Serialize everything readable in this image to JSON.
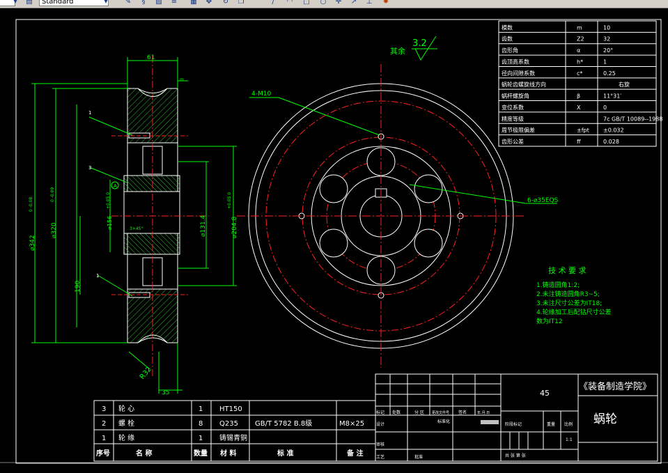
{
  "toolbar": {
    "layer_combo": "",
    "style_combo": "Standard",
    "icons": [
      "dropdown-icon",
      "table-style-icon",
      "dropdown-icon",
      "pencil-icon",
      "swirl-icon",
      "hatch-icon",
      "text-icon",
      "move-icon",
      "rotate-icon",
      "copy-icon",
      "line-icon",
      "rectangle-icon",
      "circle-icon",
      "arrow-icon",
      "highlight-icon"
    ]
  },
  "colors": {
    "background": "#000000",
    "outline": "#ffffff",
    "center_line": "#ff2020",
    "dimension": "#00ff00",
    "title_accent": "#00ff00"
  },
  "side_view": {
    "dim_61": "61",
    "dim_35": "35",
    "dim_190": "190",
    "dim_diam_342": "⌀342",
    "dim_diam_320": "⌀320",
    "dim_diam_131": "⌀131.4",
    "dim_diam_204": "⌀204.8",
    "dim_diam_hub": "⌀156",
    "tol_342": "0  -0.08",
    "tol_320": "0  -0.09",
    "tol_204": "+0.05  0",
    "tol_hub": "+0.05  0",
    "radius": "R32",
    "chamfer_top": "m",
    "label_keyway": "3×45°",
    "leader_1a": "1",
    "leader_3": "3",
    "leader_1b": "1",
    "datum": "A"
  },
  "front_view": {
    "note_holes_4": "4-M10",
    "note_holes_6": "6-⌀35EQS"
  },
  "surface_finish": {
    "label": "其余",
    "value": "3.2"
  },
  "param_table": [
    {
      "name": "模数",
      "symbol": "m",
      "value": "10"
    },
    {
      "name": "齿数",
      "symbol": "Z2",
      "value": "32"
    },
    {
      "name": "齿形角",
      "symbol": "α",
      "value": "20°"
    },
    {
      "name": "齿顶高系数",
      "symbol": "h*",
      "value": "1"
    },
    {
      "name": "径向间隙系数",
      "symbol": "c*",
      "value": "0.25"
    },
    {
      "name": "蜗轮齿螺旋线方向",
      "symbol": "",
      "value": "右旋"
    },
    {
      "name": "蜗杆螺旋角",
      "symbol": "β",
      "value": "11°31′"
    },
    {
      "name": "变位系数",
      "symbol": "X",
      "value": "0"
    },
    {
      "name": "精度等级",
      "symbol": "",
      "value": "7c GB/T 10089--1988"
    },
    {
      "name": "周节极限偏差",
      "symbol": "±fpt",
      "value": "±0.032"
    },
    {
      "name": "齿形公差",
      "symbol": "ff",
      "value": "0.028"
    }
  ],
  "tech_requirements": {
    "title": "技 术 要 求",
    "items": [
      "1.铸造圆角1:2;",
      "2.未注铸造圆角R3~5;",
      "3.未注尺寸公差为IT18;",
      "4.轮缘加工后配钻尺寸公差",
      "  数为IT12"
    ]
  },
  "bom": {
    "rows": [
      {
        "no": "3",
        "name": "轮  心",
        "qty": "1",
        "material": "HT150",
        "standard": "",
        "note": ""
      },
      {
        "no": "2",
        "name": "螺  栓",
        "qty": "8",
        "material": "Q235",
        "standard": "GB/T 5782  B.8级",
        "note": "M8×25"
      },
      {
        "no": "1",
        "name": "轮  缘",
        "qty": "1",
        "material": "铸锡青铜",
        "standard": "",
        "note": ""
      }
    ],
    "header": {
      "no": "序号",
      "name": "名  称",
      "qty": "数量",
      "material": "材 料",
      "standard": "标    准",
      "note": "备 注"
    }
  },
  "title_block": {
    "part_code": "45",
    "company": "《装备制造学院》",
    "part_name": "蜗轮",
    "scale_value": "1:1",
    "labels": {
      "mark": "标记",
      "place": "处数",
      "zone": "分 区",
      "change_doc": "更改文件号",
      "sign": "签名",
      "date": "年.月.日",
      "design": "设计",
      "standardize": "标准化",
      "stage_mark": "阶段标记",
      "weight": "重量",
      "scale": "比例",
      "review": "审核",
      "process": "工艺",
      "approve": "批准",
      "sheets": "共   张  第   张"
    }
  }
}
